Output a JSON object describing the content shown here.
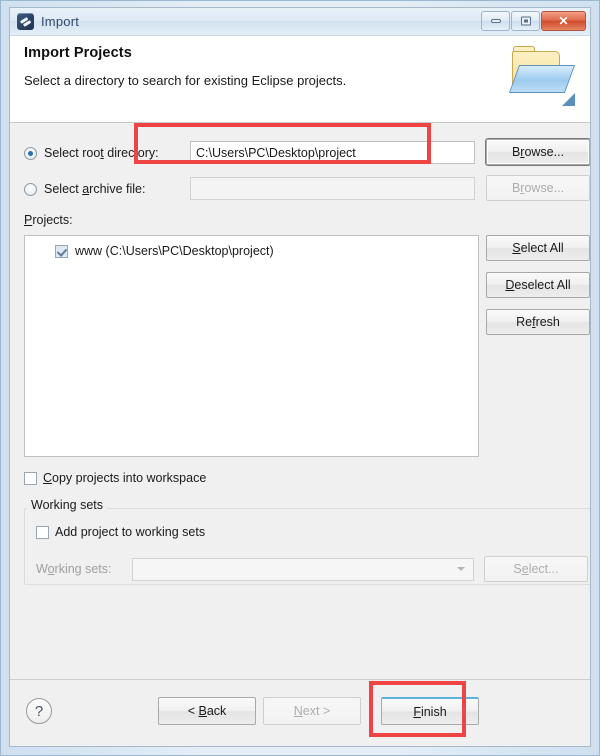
{
  "window": {
    "title": "Import",
    "icon": "eclipse-icon",
    "controls": {
      "minimize": "minimize-icon",
      "maximize": "maximize-icon",
      "close": "✕"
    }
  },
  "header": {
    "title": "Import Projects",
    "description": "Select a directory to search for existing Eclipse projects.",
    "icon": "open-folder-icon"
  },
  "source": {
    "root_directory": {
      "label_pre": "Select roo",
      "label_mnemonic": "t",
      "label_post": " directory:",
      "label_full": "Select root directory:",
      "selected": true,
      "value": "C:\\Users\\PC\\Desktop\\project",
      "browse_label_pre": "B",
      "browse_label_mnemonic": "r",
      "browse_label_post": "owse...",
      "browse_label_full": "Browse..."
    },
    "archive_file": {
      "label_pre": "Select ",
      "label_mnemonic": "a",
      "label_post": "rchive file:",
      "label_full": "Select archive file:",
      "selected": false,
      "value": "",
      "browse_label_pre": "B",
      "browse_label_mnemonic": "r",
      "browse_label_post": "owse...",
      "browse_label_full": "Browse...",
      "disabled": true
    }
  },
  "projects": {
    "label_mnemonic": "P",
    "label_post": "rojects:",
    "label_full": "Projects:",
    "items": [
      {
        "name": "www",
        "path": "(C:\\Users\\PC\\Desktop\\project)",
        "text": "www (C:\\Users\\PC\\Desktop\\project)",
        "checked": true
      }
    ],
    "buttons": {
      "select_all_mnemonic": "S",
      "select_all_post": "elect All",
      "select_all_full": "Select All",
      "deselect_all_mnemonic": "D",
      "deselect_all_post": "eselect All",
      "deselect_all_full": "Deselect All",
      "refresh_pre": "Re",
      "refresh_mnemonic": "f",
      "refresh_post": "resh",
      "refresh_full": "Refresh"
    }
  },
  "options": {
    "copy_projects": {
      "mnemonic": "C",
      "label_post": "opy projects into workspace",
      "label_full": "Copy projects into workspace",
      "checked": false
    },
    "working_sets_group": {
      "legend": "Working sets",
      "add_project": {
        "label_full": "Add project to working sets",
        "checked": false
      },
      "working_sets_field": {
        "label_pre": "W",
        "label_mnemonic": "o",
        "label_post": "rking sets:",
        "label_full": "Working sets:",
        "value": "",
        "disabled": true
      },
      "select_button": {
        "label_pre": "S",
        "label_mnemonic": "e",
        "label_post": "lect...",
        "label_full": "Select...",
        "disabled": true
      }
    }
  },
  "footer": {
    "help_label": "?",
    "back": {
      "pre": "< ",
      "mnemonic": "B",
      "post": "ack",
      "full": "< Back",
      "disabled": false
    },
    "next": {
      "pre": "",
      "mnemonic": "N",
      "post": "ext >",
      "full": "Next >",
      "disabled": true
    },
    "finish": {
      "pre": "",
      "mnemonic": "F",
      "post": "inish",
      "full": "Finish",
      "disabled": false,
      "focused": true
    }
  },
  "annotations": {
    "color": "#ee4444",
    "items": [
      {
        "target": "root-directory-textbox",
        "note": "highlighted path field"
      },
      {
        "target": "finish-button",
        "note": "highlighted finish button"
      }
    ]
  }
}
